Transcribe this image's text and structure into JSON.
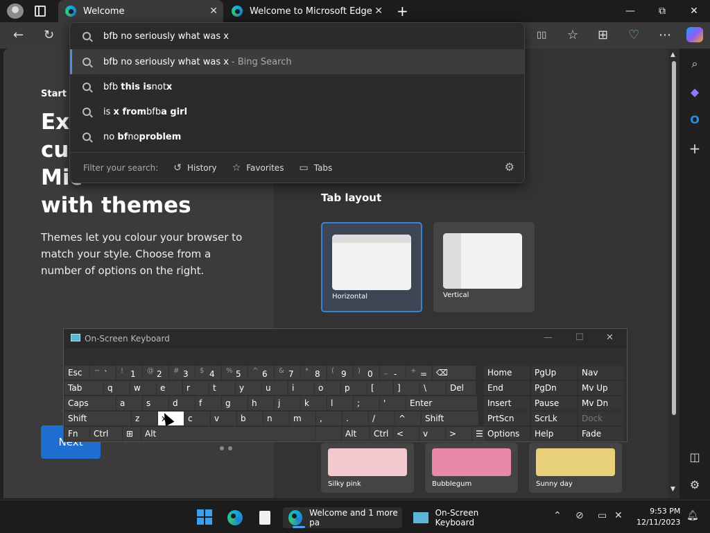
{
  "tabs": [
    {
      "title": "Welcome"
    },
    {
      "title": "Welcome to Microsoft Edge"
    }
  ],
  "window": {
    "minimize": "—",
    "restore": "⧉",
    "close": "✕"
  },
  "toolbar": {
    "back": "←",
    "refresh": "↻",
    "split": "▯▯",
    "favorites": "☆",
    "collections": "⊞",
    "health": "♡",
    "more": "⋯"
  },
  "omnibox": {
    "query": "bfb no seriously what was x",
    "suggestions": [
      {
        "text": "bfb no seriously what was x",
        "suffix": "- Bing Search"
      },
      {
        "pre": "bfb ",
        "bold": "this is",
        "mid": " not ",
        "post": "x"
      },
      {
        "pre": "is ",
        "bold": "x from",
        "mid": " bfb ",
        "post": "a girl"
      },
      {
        "pre": "no ",
        "bold": "bf",
        "mid": " no ",
        "post": "problem"
      }
    ],
    "filter_label": "Filter your search:",
    "filters": [
      "History",
      "Favorites",
      "Tabs"
    ]
  },
  "page": {
    "start_label": "Start b",
    "heading_lines": [
      "Exp",
      "cus",
      "Mic",
      "with themes"
    ],
    "description": "Themes let you colour your browser to match your style. Choose from a number of options on the right.",
    "next": "Next",
    "tab_layout_title": "Tab layout",
    "layouts": [
      "Horizontal",
      "Vertical"
    ],
    "themes": [
      {
        "name": "Silky pink",
        "color": "#f2c9cf"
      },
      {
        "name": "Bubblegum",
        "color": "#e888aa"
      },
      {
        "name": "Sunny day",
        "color": "#e9d07a"
      }
    ]
  },
  "osk": {
    "title": "On-Screen Keyboard",
    "row1": [
      {
        "label": "Esc"
      },
      {
        "sub": "~",
        "main": "`"
      },
      {
        "sub": "!",
        "main": "1"
      },
      {
        "sub": "@",
        "main": "2"
      },
      {
        "sub": "#",
        "main": "3"
      },
      {
        "sub": "$",
        "main": "4"
      },
      {
        "sub": "%",
        "main": "5"
      },
      {
        "sub": "^",
        "main": "6"
      },
      {
        "sub": "&",
        "main": "7"
      },
      {
        "sub": "*",
        "main": "8"
      },
      {
        "sub": "(",
        "main": "9"
      },
      {
        "sub": ")",
        "main": "0"
      },
      {
        "sub": "_",
        "main": "-"
      },
      {
        "sub": "+",
        "main": "="
      },
      {
        "label": "⌫"
      }
    ],
    "row2": [
      "Tab",
      "q",
      "w",
      "e",
      "r",
      "t",
      "y",
      "u",
      "i",
      "o",
      "p",
      "[",
      "]",
      "\\",
      "Del"
    ],
    "row3": [
      "Caps",
      "a",
      "s",
      "d",
      "f",
      "g",
      "h",
      "j",
      "k",
      "l",
      ";",
      "'",
      "Enter"
    ],
    "row4": [
      "Shift",
      "z",
      "x",
      "c",
      "v",
      "b",
      "n",
      "m",
      ",",
      ".",
      "/",
      "^",
      "Shift"
    ],
    "row5": [
      "Fn",
      "Ctrl",
      "⊞",
      "Alt",
      "",
      "Alt",
      "Ctrl",
      "<",
      "v",
      ">",
      "☰"
    ],
    "nav": [
      [
        "Home",
        "PgUp",
        "Nav"
      ],
      [
        "End",
        "PgDn",
        "Mv Up"
      ],
      [
        "Insert",
        "Pause",
        "Mv Dn"
      ],
      [
        "PrtScn",
        "ScrLk",
        "Dock"
      ],
      [
        "Options",
        "Help",
        "Fade"
      ]
    ]
  },
  "taskbar": {
    "edge_window": "Welcome and 1 more pa",
    "osk_window": "On-Screen Keyboard",
    "time": "9:53 PM",
    "date": "12/11/2023"
  }
}
